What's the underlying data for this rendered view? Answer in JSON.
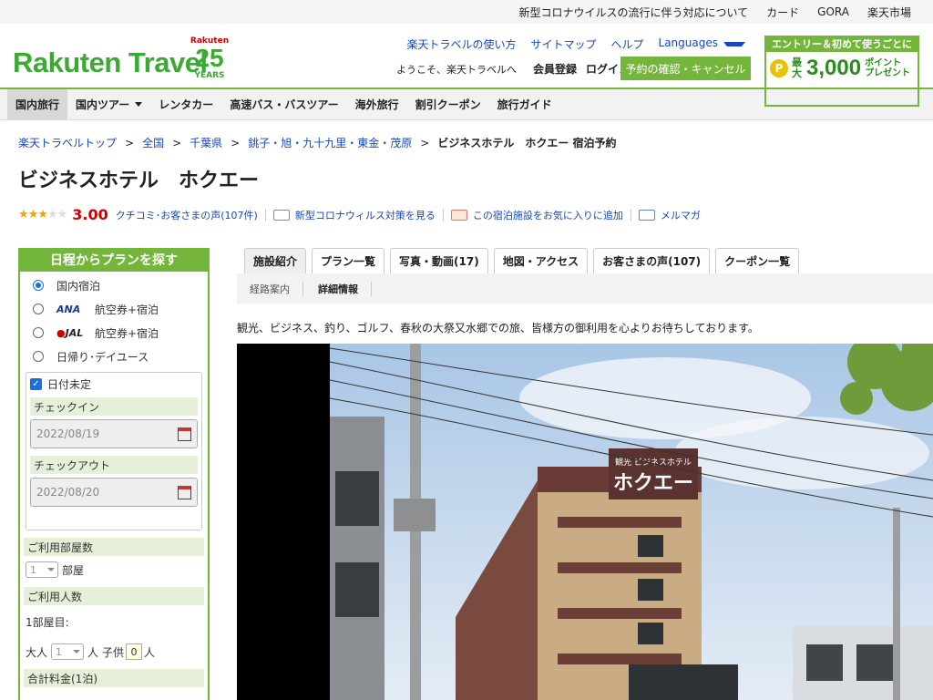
{
  "topbar": {
    "links": [
      "新型コロナウイルスの流行に伴う対応について",
      "カード",
      "GORA",
      "楽天市場"
    ]
  },
  "header": {
    "logo": "Rakuten Travel",
    "anniv_brand": "Rakuten",
    "anniv_num": "25",
    "anniv_years": "YEARS",
    "links": [
      "楽天トラベルの使い方",
      "サイトマップ",
      "ヘルプ",
      "Languages"
    ],
    "welcome": "ようこそ、楽天トラベルへ",
    "register": "会員登録",
    "login": "ログイン",
    "confirm_btn": "予約の確認・キャンセル",
    "promo_top": "エントリー＆初めて使うごとに",
    "promo_coin": "P",
    "promo_max": "最大",
    "promo_num": "3,000",
    "promo_unit1": "ポイント",
    "promo_unit2": "プレゼント"
  },
  "gnav": [
    "国内旅行",
    "国内ツアー",
    "レンタカー",
    "高速バス・バスツアー",
    "海外旅行",
    "割引クーポン",
    "旅行ガイド"
  ],
  "breadcrumb": [
    "楽天トラベルトップ",
    "全国",
    "千葉県",
    "銚子・旭・九十九里・東金・茂原",
    "ビジネスホテル　ホクエー 宿泊予約"
  ],
  "breadcrumb_sep": ">",
  "hotel": {
    "title": "ビジネスホテル　ホクエー",
    "stars_filled": "★★★",
    "stars_empty": "★★",
    "score": "3.00",
    "reviews_link": "クチコミ･お客さまの声(107件)",
    "covid_link": "新型コロナウィルス対策を見る",
    "fav_link": "この宿泊施設をお気に入りに追加",
    "mail_link": "メルマガ"
  },
  "sidebar": {
    "heading": "日程からプランを探す",
    "options": {
      "domestic": "国内宿泊",
      "ana_logo": "ANA",
      "ana": "航空券+宿泊",
      "jal_logo": "JAL",
      "jal": "航空券+宿泊",
      "day": "日帰り･デイユース"
    },
    "date_undecided": "日付未定",
    "checkin_label": "チェックイン",
    "checkin_value": "2022/08/19",
    "checkout_label": "チェックアウト",
    "checkout_value": "2022/08/20",
    "rooms_label": "ご利用部屋数",
    "rooms_value": "1",
    "rooms_unit": "部屋",
    "guests_label": "ご利用人数",
    "room1": "1部屋目:",
    "adult": "大人",
    "adult_value": "1",
    "adult_unit": "人",
    "child": "子供",
    "child_value": "0",
    "child_unit": "人",
    "total_label": "合計料金(1泊)"
  },
  "tabs": [
    "施設紹介",
    "プラン一覧",
    "写真・動画(17)",
    "地図・アクセス",
    "お客さまの声(107)",
    "クーポン一覧"
  ],
  "subtabs": [
    "経路案内",
    "詳細情報"
  ],
  "intro": "観光、ビジネス、釣り、ゴルフ、春秋の大祭又水郷での旅、皆様方の御利用を心よりお待ちしております。",
  "photo_sign": "ホクエー",
  "photo_sign_small": "観光 ビジネスホテル"
}
